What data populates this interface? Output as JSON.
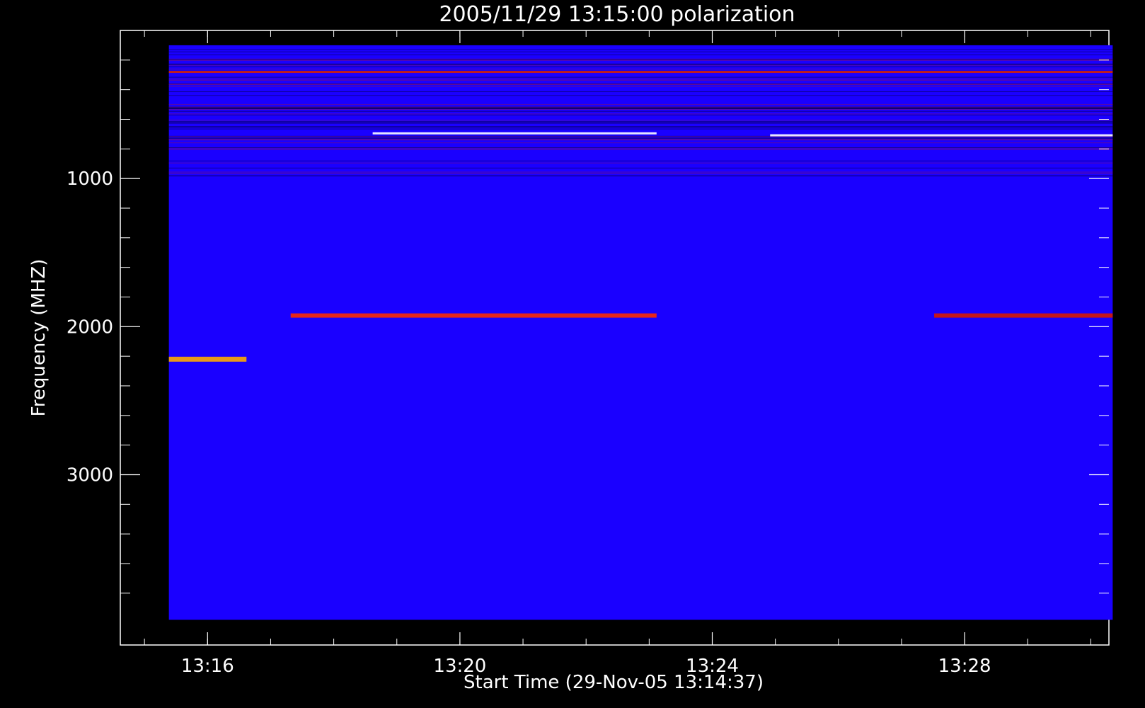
{
  "chart_data": {
    "type": "heatmap",
    "title": "2005/11/29 13:15:00 polarization",
    "xlabel": "Start Time (29-Nov-05 13:14:37)",
    "ylabel": "Frequency (MHZ)",
    "x_ticks": [
      "13:16",
      "13:20",
      "13:24",
      "13:28"
    ],
    "x_tick_minutes": [
      1.383,
      5.383,
      9.383,
      13.383
    ],
    "x_range_minutes": [
      0,
      15.67
    ],
    "data_range_minutes": [
      0.77,
      15.73
    ],
    "y_ticks": [
      1000,
      2000,
      3000
    ],
    "y_range": [
      0,
      4150
    ],
    "y_reversed": true,
    "data_range_mhz": [
      100,
      3980
    ],
    "background_color": "#1a00ff",
    "colors": {
      "low": "#000000",
      "mid": "#cc1100",
      "high": "#ffee88",
      "base": "#1a00ff"
    },
    "features": [
      {
        "name": "interference band",
        "freq_mhz": 280,
        "start_min": 0.77,
        "end_min": 15.73,
        "color": "#d02010"
      },
      {
        "name": "strong line",
        "freq_mhz": 695,
        "start_min": 4.0,
        "end_min": 8.5,
        "color": "#ffffff"
      },
      {
        "name": "strong line",
        "freq_mhz": 708,
        "start_min": 10.3,
        "end_min": 15.73,
        "color": "#ffffff"
      },
      {
        "name": "emission band",
        "freq_mhz": 1925,
        "start_min": 2.7,
        "end_min": 8.5,
        "color": "#ff2a00"
      },
      {
        "name": "emission band",
        "freq_mhz": 1925,
        "start_min": 12.9,
        "end_min": 15.73,
        "color": "#d81800"
      },
      {
        "name": "burst",
        "freq_mhz": 2220,
        "start_min": 0.77,
        "end_min": 2.0,
        "color": "#ffaa00"
      }
    ]
  }
}
